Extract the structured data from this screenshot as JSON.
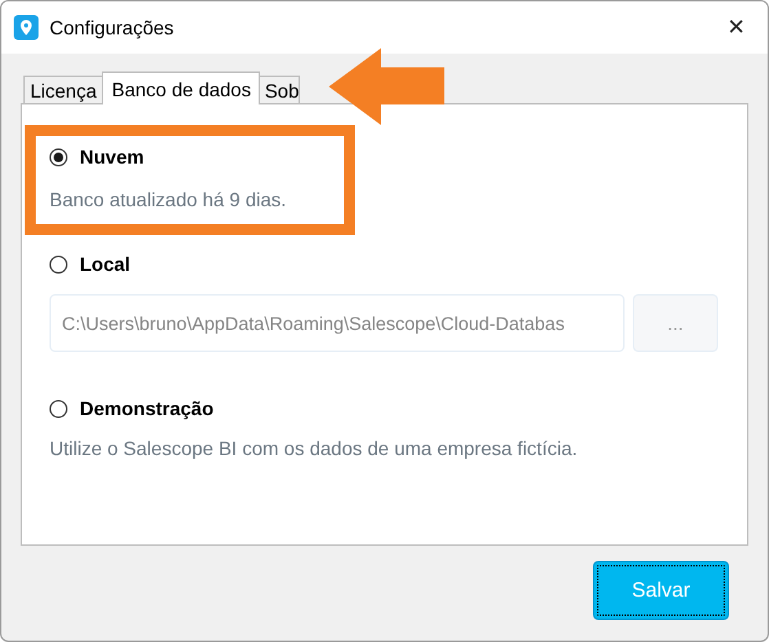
{
  "window": {
    "title": "Configurações",
    "close": "✕"
  },
  "tabs": [
    {
      "label": "Licença",
      "selected": false
    },
    {
      "label": "Banco de dados",
      "selected": true
    },
    {
      "label": "Sob",
      "selected": false
    }
  ],
  "options": [
    {
      "label": "Nuvem",
      "selected": true,
      "description": "Banco atualizado há 9 dias."
    },
    {
      "label": "Local",
      "selected": false,
      "path": "C:\\Users\\bruno\\AppData\\Roaming\\Salescope\\Cloud-Databas",
      "browse": "..."
    },
    {
      "label": "Demonstração",
      "selected": false,
      "description": "Utilize o Salescope BI com os dados de uma empresa fictícia."
    }
  ],
  "save_button": "Salvar"
}
